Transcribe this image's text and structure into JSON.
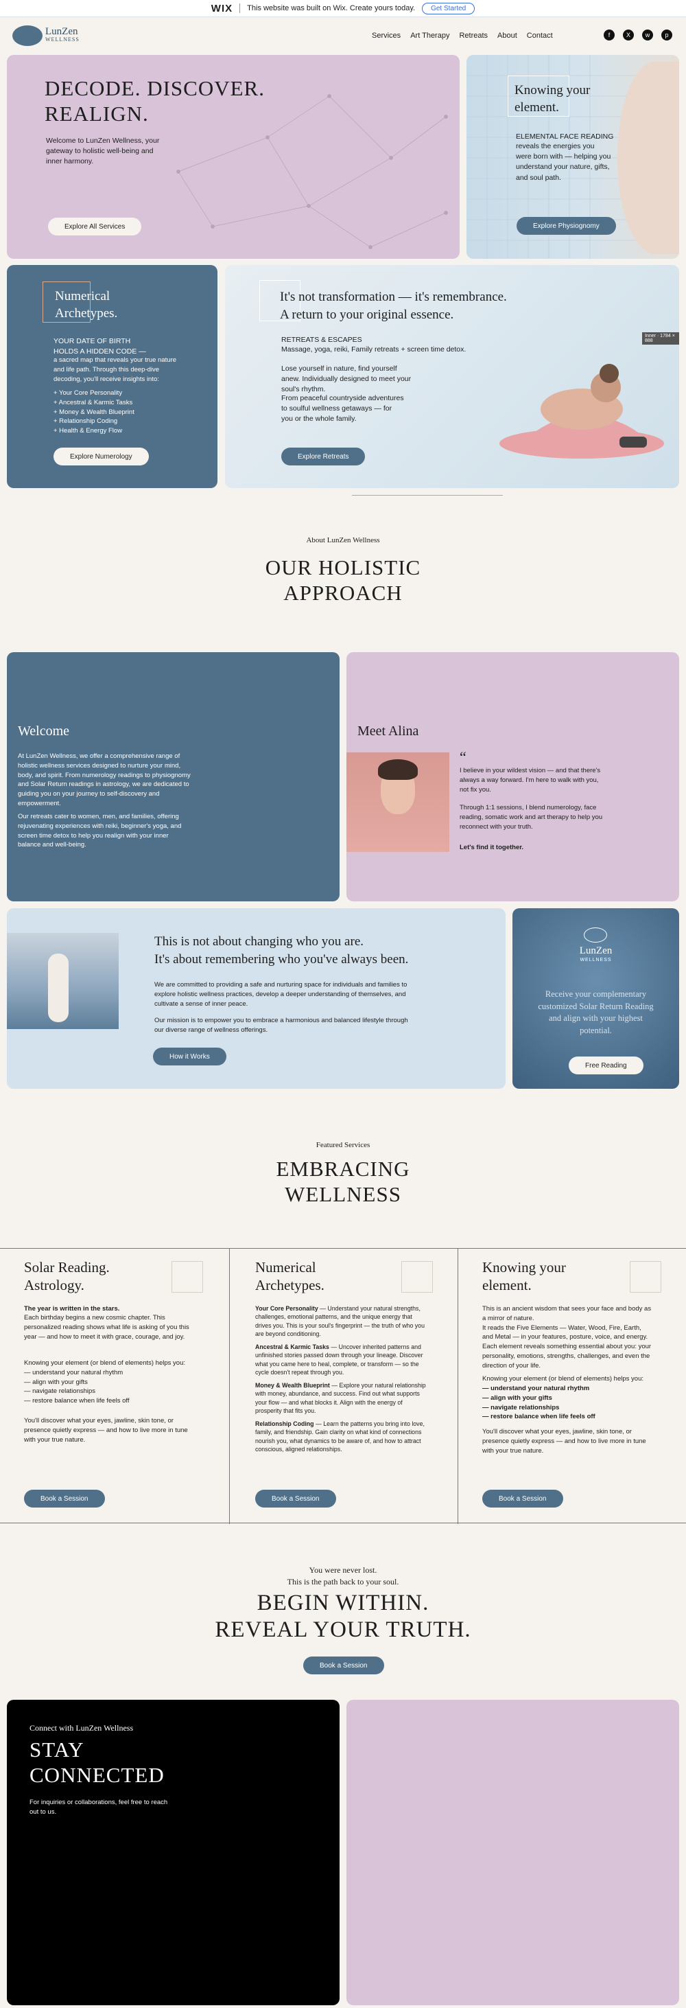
{
  "wixbar": {
    "logo": "WIX",
    "message": "This website was built on Wix. Create yours today.",
    "cta": "Get Started"
  },
  "brand": {
    "name": "LunZen",
    "sub": "WELLNESS"
  },
  "nav": [
    "Services",
    "Art Therapy",
    "Retreats",
    "About",
    "Contact"
  ],
  "social": [
    "f",
    "X",
    "w",
    "p"
  ],
  "hero": {
    "title_line1": "DECODE. DISCOVER.",
    "title_line2": "REALIGN.",
    "text": "Welcome to LunZen Wellness, your gateway to holistic well-being and inner harmony.",
    "button": "Explore All Services"
  },
  "face_card": {
    "title": "Knowing your element.",
    "label": "ELEMENTAL FACE READING",
    "text": "reveals the energies you were born with — helping you understand your nature, gifts, and soul path.",
    "button": "Explore Physiognomy"
  },
  "num_card": {
    "title": "Numerical Archetypes.",
    "label": "YOUR DATE OF BIRTH HOLDS A HIDDEN CODE —",
    "text": "a sacred map that reveals your true nature and life path. Through this deep-dive decoding, you'll receive insights into:",
    "items": [
      "+ Your Core Personality",
      "+ Ancestral & Karmic Tasks",
      "+ Money & Wealth Blueprint",
      "+ Relationship Coding",
      "+ Health & Energy Flow"
    ],
    "button": "Explore Numerology"
  },
  "retreat_card": {
    "title_line1": "It's not transformation — it's remembrance.",
    "title_line2": "A return to your original essence.",
    "label": "RETREATS & ESCAPES",
    "sublabel": "Massage, yoga, reiki, Family retreats + screen time detox.",
    "p1": "Lose yourself in nature, find yourself anew. Individually designed to meet your soul's rhythm.",
    "p2": "From peaceful countryside adventures to soulful wellness getaways — for you or the whole family.",
    "button": "Explore Retreats",
    "badge": "Inner · 1784 × 888"
  },
  "about": {
    "eyebrow": "About LunZen Wellness",
    "title_line1": "OUR HOLISTIC",
    "title_line2": "APPROACH"
  },
  "welcome": {
    "title": "Welcome",
    "p1": "At LunZen Wellness, we offer a comprehensive range of holistic wellness services designed to nurture your mind, body, and spirit. From numerology readings to physiognomy and Solar Return readings in astrology, we are dedicated to guiding you on your journey to self-discovery and empowerment.",
    "p2": "Our retreats cater to women, men, and families, offering rejuvenating experiences with reiki, beginner's yoga, and screen time detox to help you realign with your inner balance and well-being."
  },
  "alina": {
    "title": "Meet Alina",
    "quote_mark": "“",
    "p1": "I believe in your wildest vision — and that there's always a way forward. I'm here to walk with you, not fix you.",
    "p2": "Through 1:1 sessions, I blend numerology, face reading, somatic work and art therapy to help you reconnect with your truth.",
    "p3": "Let's find it together."
  },
  "remember": {
    "title_line1": "This is not about changing who you are.",
    "title_line2": "It's about remembering who you've always been.",
    "p1": "We are committed to providing a safe and nurturing space for individuals and families to explore holistic wellness practices, develop a deeper understanding of themselves, and cultivate a sense of inner peace.",
    "p2": "Our mission is to empower you to embrace a harmonious and balanced lifestyle through our diverse range of wellness offerings.",
    "button": "How it Works"
  },
  "free_card": {
    "brand": "LunZen",
    "sub": "WELLNESS",
    "text": "Receive your complementary customized Solar Return Reading and align with your highest potential.",
    "button": "Free Reading"
  },
  "featured": {
    "eyebrow": "Featured Services",
    "title_line1": "EMBRACING",
    "title_line2": "WELLNESS"
  },
  "services": [
    {
      "title_line1": "Solar Reading.",
      "title_line2": "Astrology.",
      "lead": "The year is written in the stars.",
      "p1": "Each birthday begins a new cosmic chapter. This personalized reading shows what life is asking of you this year — and how to meet it with grace, courage, and joy.",
      "p2": "Knowing your element (or blend of elements) helps you:",
      "list": [
        "— understand your natural rhythm",
        "— align with your gifts",
        "— navigate relationships",
        "— restore balance when life feels off"
      ],
      "p3": "You'll discover what your eyes, jawline, skin tone, or presence quietly express — and how to live more in tune with your true nature.",
      "button": "Book a Session"
    },
    {
      "title_line1": "Numerical",
      "title_line2": "Archetypes.",
      "items": [
        {
          "head": "Your Core Personality",
          "text": " — Understand your natural strengths, challenges, emotional patterns, and the unique energy that drives you. This is your soul's fingerprint — the truth of who you are beyond conditioning."
        },
        {
          "head": "Ancestral & Karmic Tasks",
          "text": " — Uncover inherited patterns and unfinished stories passed down through your lineage. Discover what you came here to heal, complete, or transform — so the cycle doesn't repeat through you."
        },
        {
          "head": "Money & Wealth Blueprint",
          "text": " — Explore your natural relationship with money, abundance, and success. Find out what supports your flow — and what blocks it. Align with the energy of prosperity that fits you."
        },
        {
          "head": "Relationship Coding",
          "text": " — Learn the patterns you bring into love, family, and friendship. Gain clarity on what kind of connections nourish you, what dynamics to be aware of, and how to attract conscious, aligned relationships."
        }
      ],
      "button": "Book a Session"
    },
    {
      "title_line1": "Knowing your",
      "title_line2": "element.",
      "p1": "This is an ancient wisdom that sees your face and body as a mirror of nature.",
      "p2": "It reads the Five Elements — Water, Wood, Fire, Earth, and Metal — in your features, posture, voice, and energy.",
      "p3": "Each element reveals something essential about you: your personality, emotions, strengths, challenges, and even the direction of your life.",
      "p4": "Knowing your element (or blend of elements) helps you:",
      "list": [
        "— understand your natural rhythm",
        "— align with your gifts",
        "— navigate relationships",
        "— restore balance when life feels off"
      ],
      "p5": "You'll discover what your eyes, jawline, skin tone, or presence quietly express — and how to live more in tune with your true nature.",
      "button": "Book a Session"
    }
  ],
  "begin": {
    "line1": "You were never lost.",
    "line2": "This is the path back to your soul.",
    "title_line1": "BEGIN WITHIN.",
    "title_line2": "REVEAL YOUR TRUTH.",
    "button": "Book a Session"
  },
  "connect": {
    "eyebrow": "Connect with LunZen Wellness",
    "title_line1": "STAY",
    "title_line2": "CONNECTED",
    "text": "For inquiries or collaborations, feel free to reach out to us."
  }
}
